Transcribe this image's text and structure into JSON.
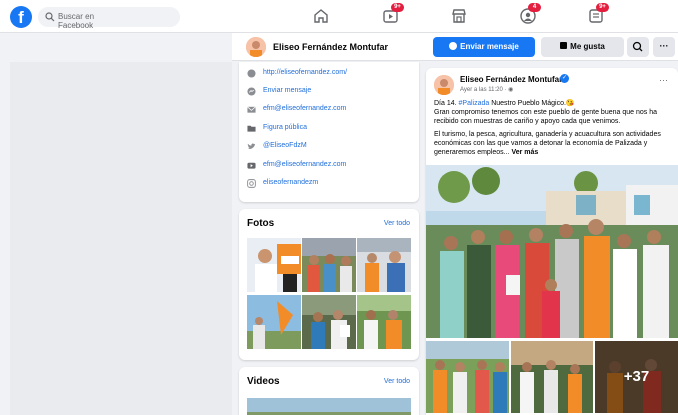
{
  "brand": {
    "logo_letter": "f",
    "color": "#1877f2"
  },
  "search": {
    "placeholder": "Buscar en Facebook"
  },
  "nav": [
    {
      "icon": "home-icon",
      "badge": ""
    },
    {
      "icon": "watch-icon",
      "badge": "9+"
    },
    {
      "icon": "marketplace-icon",
      "badge": ""
    },
    {
      "icon": "groups-icon",
      "badge": "4"
    },
    {
      "icon": "gaming-icon",
      "badge": "9+"
    }
  ],
  "page": {
    "name": "Eliseo Fernández Montufar",
    "send_message": "Enviar mensaje",
    "like": "Me gusta",
    "more": "···"
  },
  "intro": {
    "items": [
      {
        "icon": "globe-icon",
        "text": "http://eliseofernandez.com/"
      },
      {
        "icon": "messenger-icon",
        "text": "Enviar mensaje"
      },
      {
        "icon": "mail-icon",
        "text": "efm@eliseofernandez.com"
      },
      {
        "icon": "folder-icon",
        "text": "Figura pública"
      },
      {
        "icon": "twitter-icon",
        "text": "@EliseoFdzM"
      },
      {
        "icon": "youtube-icon",
        "text": "efm@eliseofernandez.com"
      },
      {
        "icon": "instagram-icon",
        "text": "eliseofernandezm"
      }
    ]
  },
  "photos": {
    "title": "Fotos",
    "see_all": "Ver todo"
  },
  "videos": {
    "title": "Videos",
    "see_all": "Ver todo"
  },
  "post": {
    "author": "Eliseo Fernández Montufar",
    "time": "Ayer a las 11:20 · ",
    "day_line_before": "Día 14. ",
    "hashtag": "#Palizada",
    "day_line_after": " Nuestro Pueblo Mágico.😘",
    "body1": "Gran compromiso tenemos con este pueblo de gente buena que nos ha recibido con muestras de cariño y apoyo cada que venimos.",
    "body2": "El turismo, la pesca, agricultura, ganadería y acuacultura son actividades económicas con las que vamos a detonar la economía de Palizada y generaremos empleos...",
    "see_more": "Ver más",
    "more_photos": "+37"
  }
}
